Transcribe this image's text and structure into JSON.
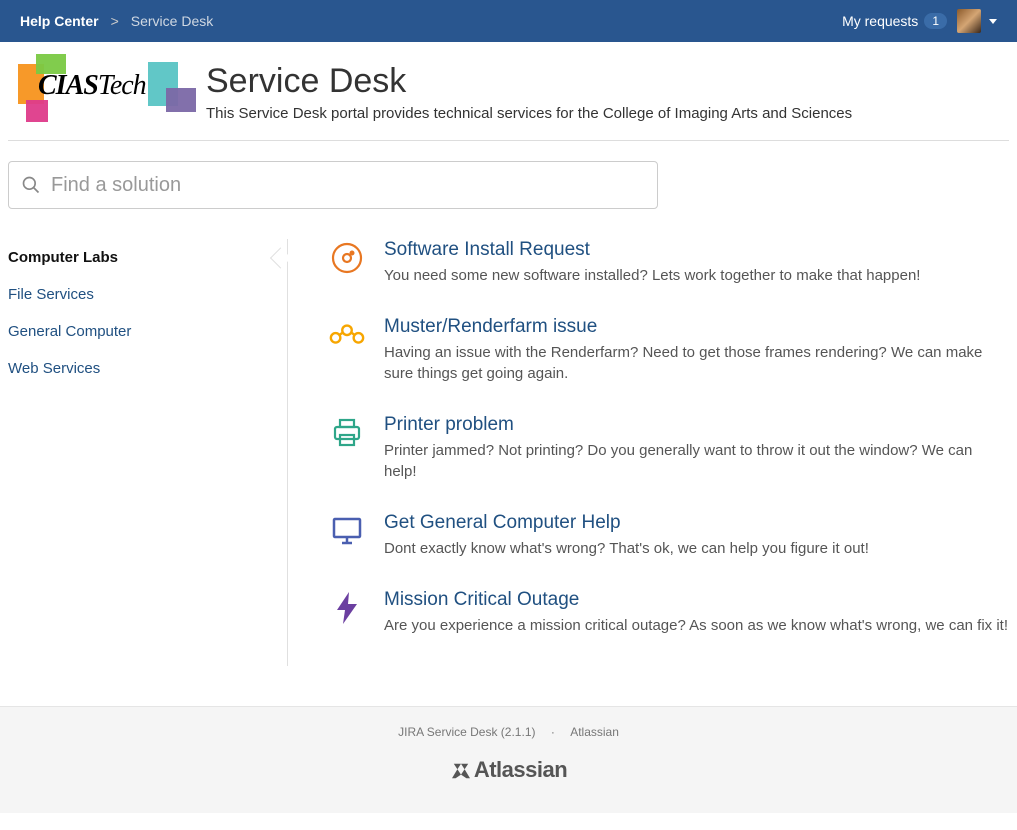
{
  "topbar": {
    "home": "Help Center",
    "separator": ">",
    "current": "Service Desk",
    "my_requests": "My requests",
    "request_count": "1"
  },
  "header": {
    "logo_text_bold": "CIAS",
    "logo_text_thin": "Tech",
    "title": "Service Desk",
    "subtitle": "This Service Desk portal provides technical services for the College of Imaging Arts and Sciences"
  },
  "search": {
    "placeholder": "Find a solution"
  },
  "sidebar": {
    "items": [
      {
        "label": "Computer Labs",
        "active": true
      },
      {
        "label": "File Services",
        "active": false
      },
      {
        "label": "General Computer",
        "active": false
      },
      {
        "label": "Web Services",
        "active": false
      }
    ]
  },
  "requests": [
    {
      "icon": "cd-icon",
      "color": "#e87722",
      "title": "Software Install Request",
      "desc": "You need some new software installed? Lets work together to make that happen!"
    },
    {
      "icon": "gears-icon",
      "color": "#f7a600",
      "title": "Muster/Renderfarm issue",
      "desc": "Having an issue with the Renderfarm? Need to get those frames rendering? We can make sure things get going again."
    },
    {
      "icon": "printer-icon",
      "color": "#2ea689",
      "title": "Printer problem",
      "desc": "Printer jammed? Not printing? Do you generally want to throw it out the window? We can help!"
    },
    {
      "icon": "monitor-icon",
      "color": "#4a5fb0",
      "title": "Get General Computer Help",
      "desc": "Dont exactly know what's wrong? That's ok, we can help you figure it out!"
    },
    {
      "icon": "lightning-icon",
      "color": "#6b3fa0",
      "title": "Mission Critical Outage",
      "desc": "Are you experience a mission critical outage? As soon as we know what's wrong, we can fix it!"
    }
  ],
  "footer": {
    "product": "JIRA Service Desk (2.1.1)",
    "dot": "·",
    "company": "Atlassian",
    "logo": "Atlassian"
  }
}
